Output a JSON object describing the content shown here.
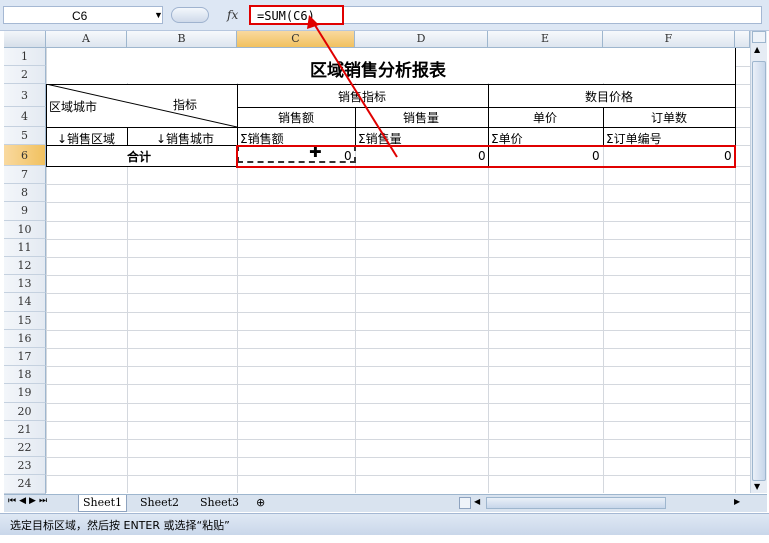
{
  "formula_bar": {
    "name_box": "C6",
    "fx_icon": "fx",
    "formula": "=SUM(C6)"
  },
  "columns": [
    "A",
    "B",
    "C",
    "D",
    "E",
    "F"
  ],
  "rows": [
    "1",
    "2",
    "3",
    "4",
    "5",
    "6",
    "7",
    "8",
    "9",
    "10",
    "11",
    "12",
    "13",
    "14",
    "15",
    "16",
    "17",
    "18",
    "19",
    "20",
    "21",
    "22",
    "23",
    "24"
  ],
  "selected": {
    "column": "C",
    "row": "6"
  },
  "sheet": {
    "title": "区域销售分析报表",
    "corner_top": "指标",
    "corner_bottom": "区域城市",
    "group1": "销售指标",
    "group2": "数目价格",
    "sub": [
      "销售额",
      "销售量",
      "单价",
      "订单数"
    ],
    "row5": [
      "↓销售区域",
      "↓销售城市",
      "Σ销售额",
      "Σ销售量",
      "Σ单价",
      "Σ订单编号"
    ],
    "total_label": "合计",
    "totals": [
      "0",
      "0",
      "0",
      "0"
    ]
  },
  "tabs": [
    "Sheet1",
    "Sheet2",
    "Sheet3"
  ],
  "status_text": "选定目标区域，然后按 ENTER 或选择“粘贴”",
  "colors": {
    "highlight": "#e00000",
    "selection": "#f1c15f"
  }
}
